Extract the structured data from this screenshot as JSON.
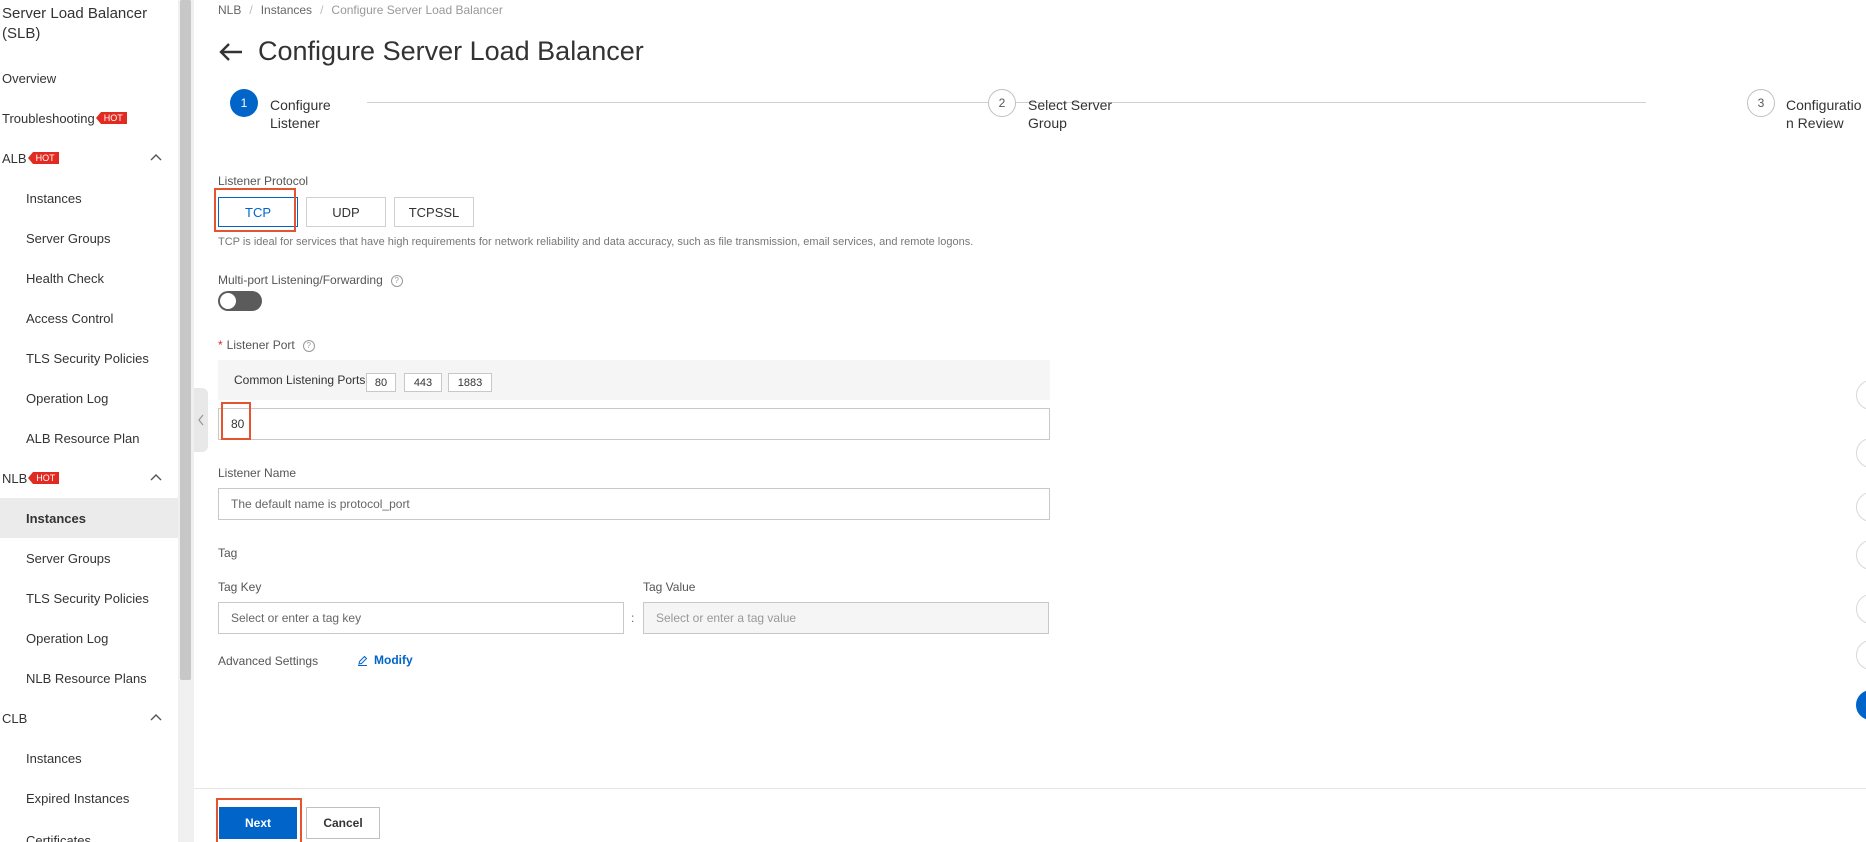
{
  "sidebar": {
    "title": "Server Load Balancer (SLB)",
    "hot_badge": "HOT",
    "items": [
      {
        "label": "Overview"
      },
      {
        "label": "Troubleshooting"
      },
      {
        "label": "ALB"
      },
      {
        "label": "Instances"
      },
      {
        "label": "Server Groups"
      },
      {
        "label": "Health Check"
      },
      {
        "label": "Access Control"
      },
      {
        "label": "TLS Security Policies"
      },
      {
        "label": "Operation Log"
      },
      {
        "label": "ALB Resource Plan"
      },
      {
        "label": "NLB"
      },
      {
        "label": "Instances"
      },
      {
        "label": "Server Groups"
      },
      {
        "label": "TLS Security Policies"
      },
      {
        "label": "Operation Log"
      },
      {
        "label": "NLB Resource Plans"
      },
      {
        "label": "CLB"
      },
      {
        "label": "Instances"
      },
      {
        "label": "Expired Instances"
      },
      {
        "label": "Certificates"
      }
    ]
  },
  "breadcrumb": [
    "NLB",
    "Instances",
    "Configure Server Load Balancer"
  ],
  "page_title": "Configure Server Load Balancer",
  "steps": [
    {
      "number": "1",
      "line1": "Configure",
      "line2": "Listener"
    },
    {
      "number": "2",
      "line1": "Select Server",
      "line2": "Group"
    },
    {
      "number": "3",
      "line1": "Configuratio",
      "line2": "n Review"
    }
  ],
  "form": {
    "protocol_label": "Listener Protocol",
    "protocols": [
      "TCP",
      "UDP",
      "TCPSSL"
    ],
    "selected_protocol": "TCP",
    "protocol_desc": "TCP is ideal for services that have high requirements for network reliability and data accuracy, such as file transmission, email services, and remote logons.",
    "multiport_label": "Multi-port Listening/Forwarding",
    "multiport_enabled": false,
    "port_label": "Listener Port",
    "common_ports_label": "Common Listening Ports:",
    "common_ports": [
      "80",
      "443",
      "1883"
    ],
    "port_value": "80",
    "name_label": "Listener Name",
    "name_placeholder": "The default name is protocol_port",
    "tag_label": "Tag",
    "tag_key_label": "Tag Key",
    "tag_value_label": "Tag Value",
    "tag_key_placeholder": "Select or enter a tag key",
    "tag_value_placeholder": "Select or enter a tag value",
    "tag_separator": ":",
    "advanced_label": "Advanced Settings",
    "modify_label": "Modify"
  },
  "footer": {
    "next_label": "Next",
    "cancel_label": "Cancel"
  },
  "colors": {
    "primary": "#0064c8",
    "hot_badge": "#e02a22",
    "highlight": "#e5532f"
  }
}
